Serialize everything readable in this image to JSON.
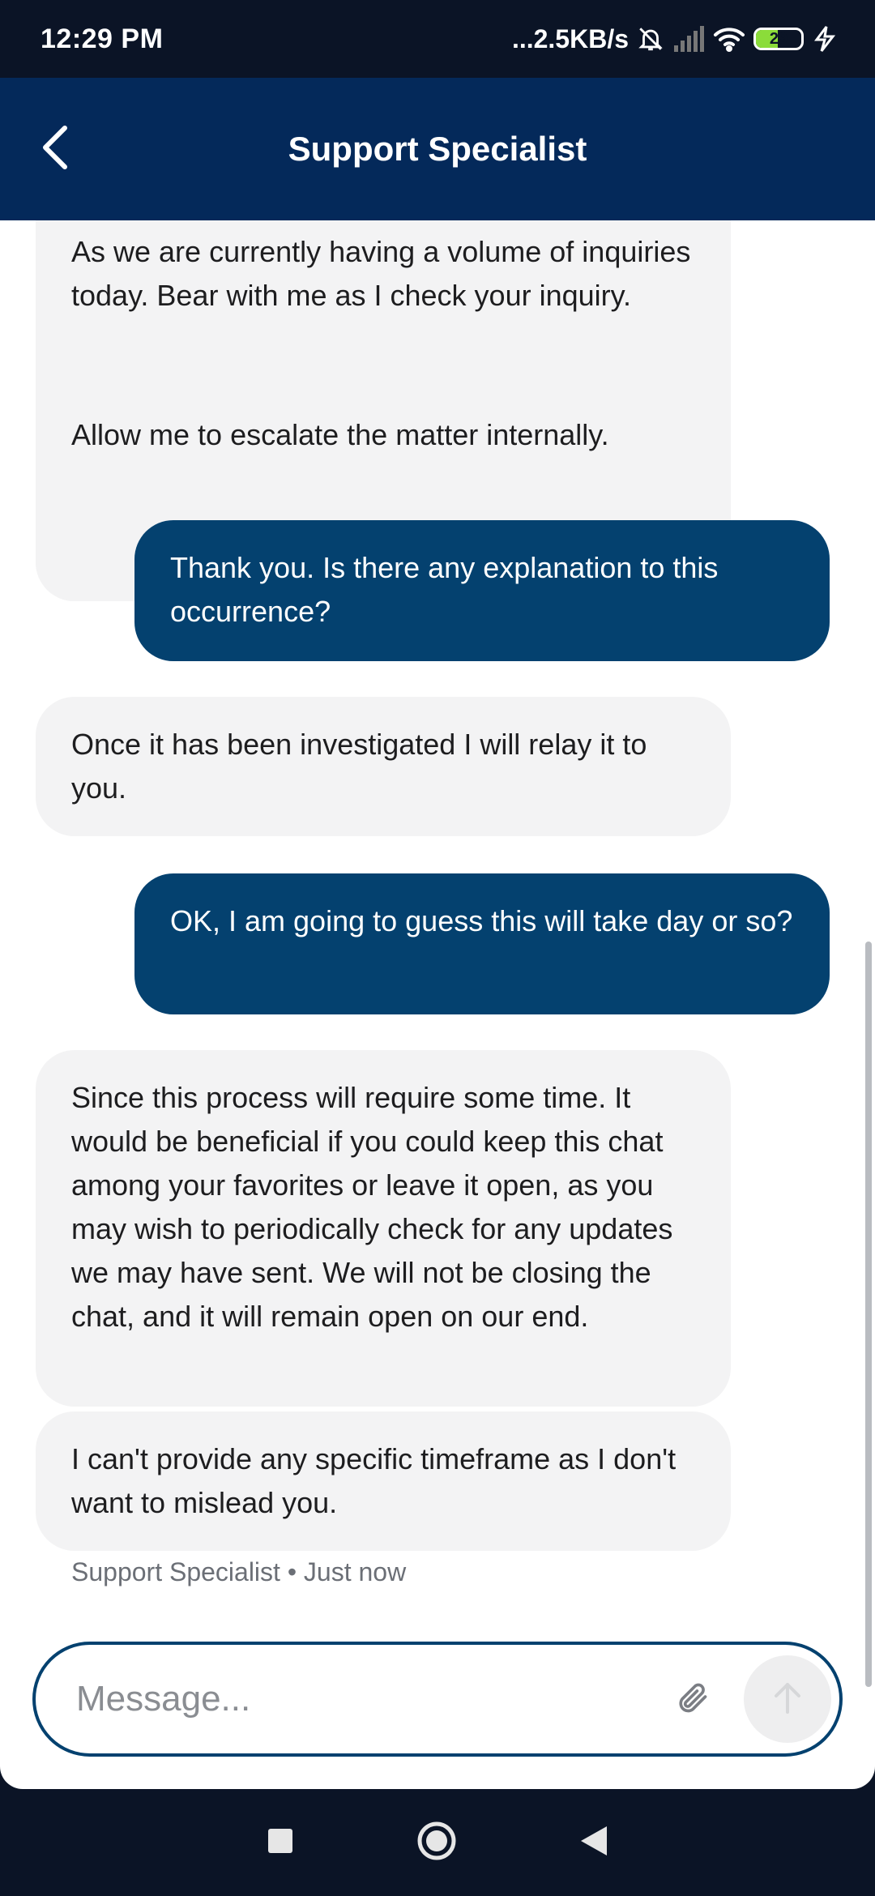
{
  "status_bar": {
    "time": "12:29 PM",
    "network_speed": "...2.5KB/s",
    "battery_level": "29"
  },
  "header": {
    "title": "Support Specialist",
    "back_icon": "chevron-left-icon"
  },
  "messages": [
    {
      "direction": "incoming",
      "text": "As we are currently having a volume of inquiries today. Bear with me as I check your inquiry."
    },
    {
      "direction": "incoming",
      "text": "Allow me to escalate the matter internally."
    },
    {
      "direction": "outgoing",
      "text": "Thank you. Is there any explanation to this occurrence?"
    },
    {
      "direction": "incoming",
      "text": "Once it has been investigated I will relay it to you."
    },
    {
      "direction": "outgoing",
      "text": "OK, I am going to guess this will take day or so?"
    },
    {
      "direction": "incoming",
      "text": "Since this process will require some time. It would be beneficial if you could keep this chat among your favorites or leave it open, as you may wish to periodically check for any updates we may have sent. We will not be closing the chat, and it will remain open on our end."
    },
    {
      "direction": "incoming",
      "text": "I can't provide any specific timeframe as I don't want to mislead you."
    }
  ],
  "last_message_meta": "Support Specialist • Just now",
  "composer": {
    "placeholder": "Message...",
    "attach_icon": "paperclip-icon",
    "send_icon": "arrow-up-icon"
  },
  "colors": {
    "header_bg": "#04295a",
    "outgoing_bubble": "#04416f",
    "incoming_bubble": "#f3f3f4",
    "system_bar": "#0b1426"
  }
}
